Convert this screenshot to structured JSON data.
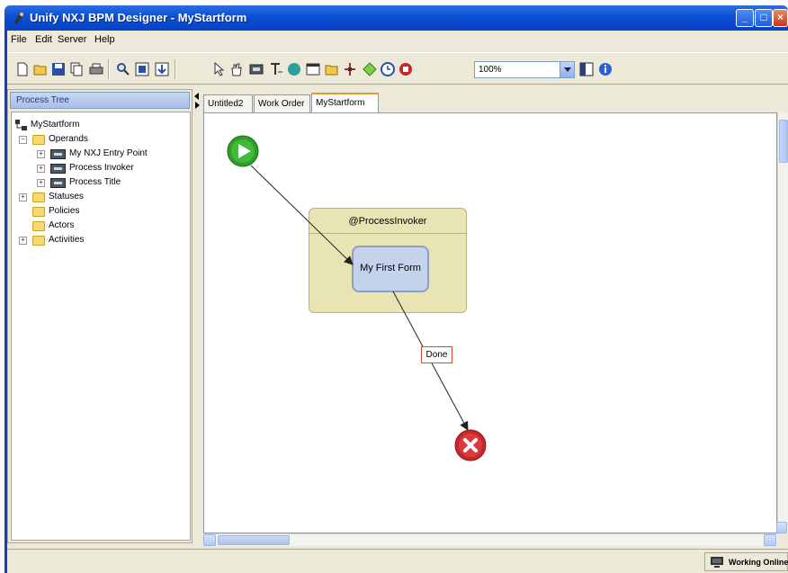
{
  "window": {
    "title": "Unify NXJ BPM Designer - MyStartform"
  },
  "menu": [
    "File",
    "Edit",
    "Server",
    "Help"
  ],
  "toolbar": {
    "zoom_value": "100%",
    "icons": [
      "new-file-icon",
      "open-folder-icon",
      "save-icon",
      "copy-icon",
      "print-icon",
      "find-icon",
      "import-icon",
      "export-icon",
      "pointer-icon",
      "hand-icon",
      "form-icon",
      "text-icon",
      "start-state-icon",
      "window-icon",
      "folder-icon",
      "split-icon",
      "decision-icon",
      "timer-icon",
      "stop-icon",
      "panel-icon",
      "info-icon"
    ]
  },
  "left_panel": {
    "title": "Process Tree",
    "root": "MyStartform",
    "tree": [
      {
        "label": "Operands",
        "level": 1,
        "expander": "−",
        "icon": "folder"
      },
      {
        "label": "My NXJ Entry Point",
        "level": 2,
        "expander": "+",
        "icon": "field"
      },
      {
        "label": "Process Invoker",
        "level": 2,
        "expander": "+",
        "icon": "field"
      },
      {
        "label": "Process Title",
        "level": 2,
        "expander": "+",
        "icon": "field"
      },
      {
        "label": "Statuses",
        "level": 1,
        "expander": "+",
        "icon": "folder"
      },
      {
        "label": "Policies",
        "level": 1,
        "expander": "",
        "icon": "folder"
      },
      {
        "label": "Actors",
        "level": 1,
        "expander": "",
        "icon": "folder"
      },
      {
        "label": "Activities",
        "level": 1,
        "expander": "+",
        "icon": "folder"
      }
    ]
  },
  "tabs": [
    {
      "label": "Untitled2",
      "active": false
    },
    {
      "label": "Work Order",
      "active": false
    },
    {
      "label": "MyStartform",
      "active": true
    }
  ],
  "diagram": {
    "lane_title": "@ProcessInvoker",
    "form_node": "My First Form",
    "transition_label": "Done",
    "colors": {
      "start": "#2e9e2a",
      "end": "#c6282b",
      "lane": "#e8e4b4",
      "node": "#c5d2ec"
    }
  },
  "status": {
    "connection": "Working Online"
  }
}
